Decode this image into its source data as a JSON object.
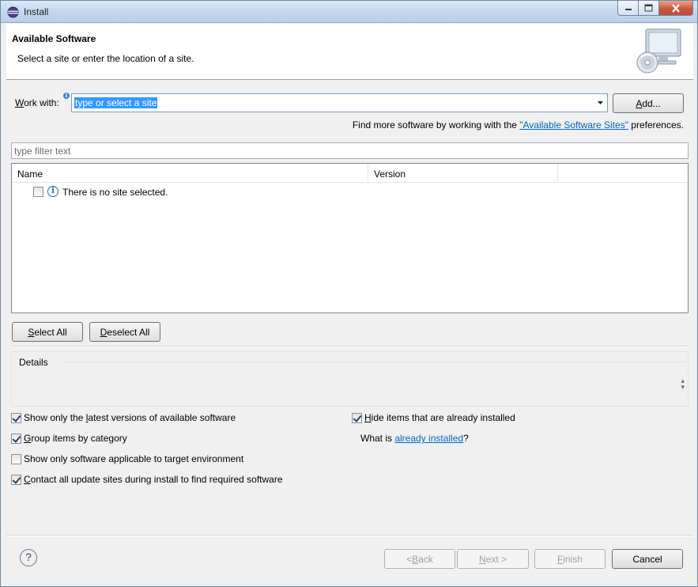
{
  "window": {
    "title": "Install",
    "minimize_icon": "minimize-icon",
    "maximize_icon": "maximize-icon",
    "close_icon": "close-icon"
  },
  "banner": {
    "title": "Available Software",
    "subtitle": "Select a site or enter the location of a site.",
    "image": "install-wizard-icon"
  },
  "work_with": {
    "label_prefix": "W",
    "label_rest": "ork with:",
    "value": "type or select a site",
    "add_prefix": "",
    "add_accel": "A",
    "add_rest": "dd..."
  },
  "more_software": {
    "before": "Find more software by working with the ",
    "link": "\"Available Software Sites\"",
    "after": " preferences."
  },
  "filter": {
    "placeholder": "type filter text"
  },
  "tree": {
    "columns": [
      "Name",
      "Version"
    ],
    "rows": [
      {
        "name": "There is no site selected.",
        "checked": false
      }
    ]
  },
  "select_buttons": {
    "select_all_accel": "S",
    "select_all_rest": "elect All",
    "deselect_all_accel": "D",
    "deselect_all_rest": "eselect All"
  },
  "details": {
    "label": "Details",
    "text": ""
  },
  "options": {
    "latest_a": "Show only the ",
    "latest_accel": "l",
    "latest_b": "atest versions of available software",
    "latest_checked": true,
    "group_accel": "G",
    "group_rest": "roup items by category",
    "group_checked": true,
    "target_label": "Show only software applicable to target environment",
    "target_checked": false,
    "contact_accel": "C",
    "contact_rest": "ontact all update sites during install to find required software",
    "contact_checked": true,
    "hide_accel": "H",
    "hide_rest": "ide items that are already installed",
    "hide_checked": true,
    "what_is_before": "What is ",
    "what_is_link": "already installed",
    "what_is_after": "?"
  },
  "footer": {
    "help_icon": "help-icon",
    "help_glyph": "?",
    "back_pre": "< ",
    "back_accel": "B",
    "back_rest": "ack",
    "next_accel": "N",
    "next_rest": "ext >",
    "finish_accel": "F",
    "finish_rest": "inish",
    "cancel": "Cancel"
  }
}
